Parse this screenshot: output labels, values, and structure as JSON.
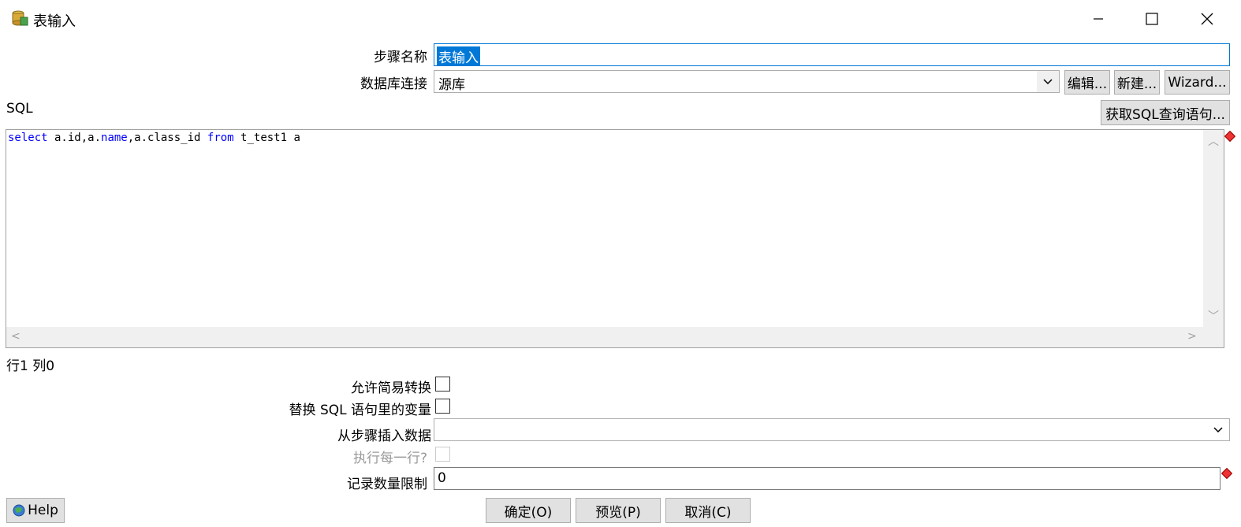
{
  "window": {
    "title": "表输入",
    "icon": "database-table-icon"
  },
  "form": {
    "step_name_label": "步骤名称",
    "step_name_value": "表输入",
    "db_connection_label": "数据库连接",
    "db_connection_value": "源库",
    "edit_button": "编辑...",
    "new_button": "新建...",
    "wizard_button": "Wizard...",
    "sql_label": "SQL",
    "get_sql_button": "获取SQL查询语句...",
    "sql_tokens": [
      {
        "t": "select",
        "kw": true
      },
      {
        "t": " a.id,a.",
        "kw": false
      },
      {
        "t": "name",
        "kw": true
      },
      {
        "t": ",a.class_id ",
        "kw": false
      },
      {
        "t": "from",
        "kw": true
      },
      {
        "t": " t_test1 a",
        "kw": false
      }
    ],
    "cursor_status": "行1 列0",
    "lazy_conversion_label": "允许简易转换",
    "replace_vars_label": "替换 SQL 语句里的变量",
    "insert_from_step_label": "从步骤插入数据",
    "insert_from_step_value": "",
    "execute_each_row_label": "执行每一行?",
    "limit_label": "记录数量限制",
    "limit_value": "0"
  },
  "footer": {
    "help_button": "Help",
    "ok_button": "确定(O)",
    "preview_button": "预览(P)",
    "cancel_button": "取消(C)"
  },
  "colors": {
    "selection": "#0078d7",
    "keyword": "#0000ff",
    "button_bg": "#e1e1e1"
  }
}
